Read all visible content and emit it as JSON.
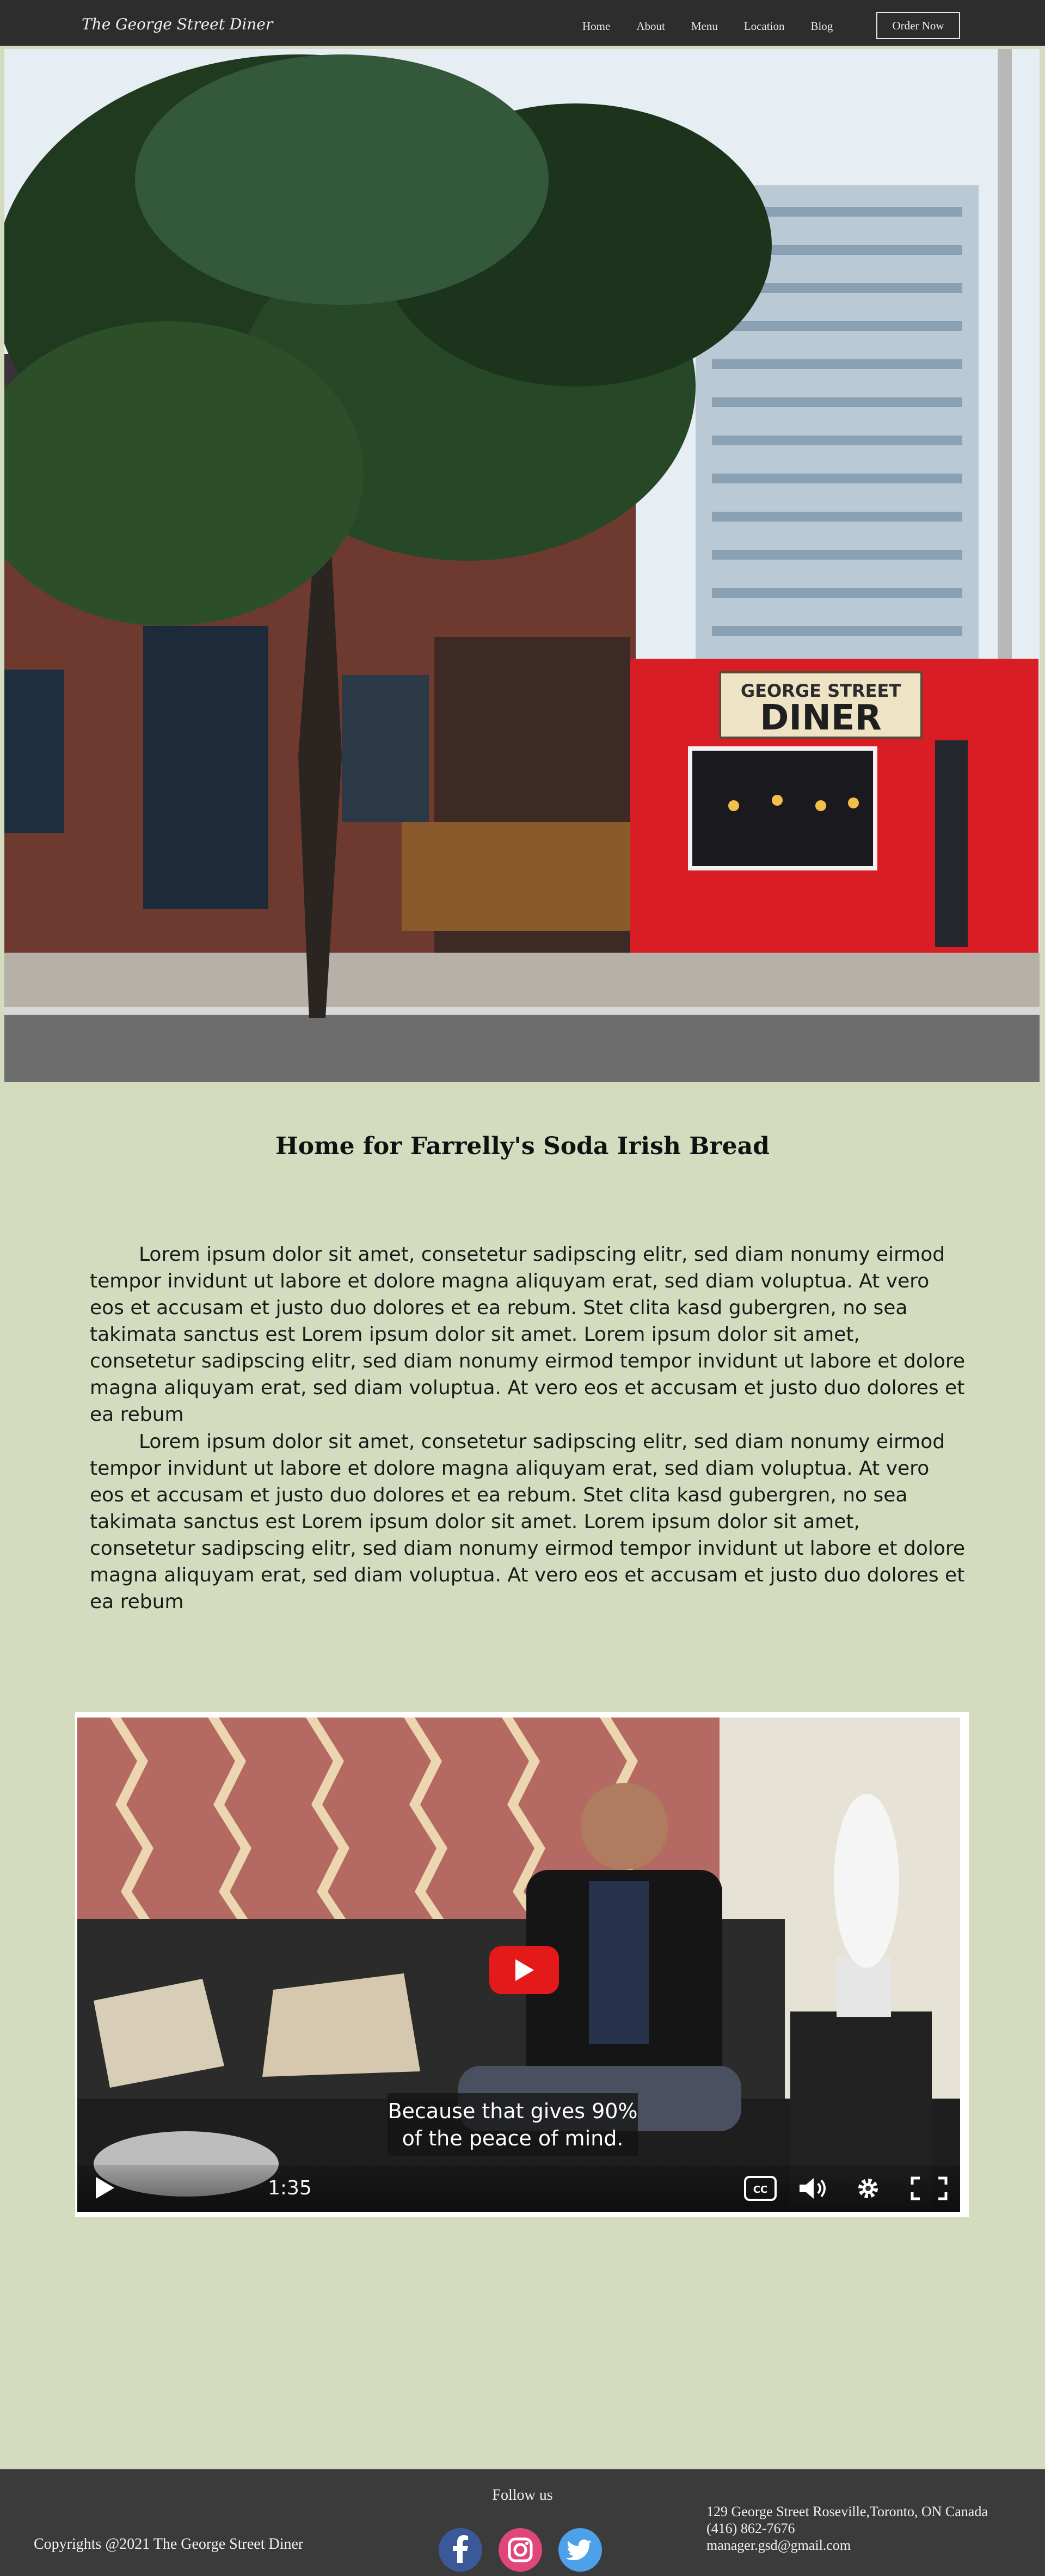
{
  "nav": {
    "brand": "The George Street Diner",
    "links": [
      "Home",
      "About",
      "Menu",
      "Location",
      "Blog"
    ],
    "cta": "Order Now"
  },
  "hero": {
    "sign_line1": "GEORGE STREET",
    "sign_line2": "DINER"
  },
  "main": {
    "title": "Home for Farrelly's Soda Irish Bread",
    "paragraph1": "Lorem ipsum dolor sit amet, consetetur sadipscing elitr, sed diam nonumy eirmod tempor invidunt ut labore et dolore magna aliquyam erat, sed diam voluptua. At vero eos et accusam et justo duo dolores et ea rebum. Stet clita kasd gubergren, no sea takimata sanctus est Lorem ipsum dolor sit amet. Lorem ipsum dolor sit amet, consetetur sadipscing elitr, sed diam nonumy eirmod tempor invidunt ut labore et dolore magna aliquyam erat, sed diam voluptua. At vero eos et accusam et justo duo dolores et ea rebum",
    "paragraph2": "Lorem ipsum dolor sit amet, consetetur sadipscing elitr, sed diam nonumy eirmod tempor invidunt ut labore et dolore magna aliquyam erat, sed diam voluptua. At vero eos et accusam et justo duo dolores et ea rebum. Stet clita kasd gubergren, no sea takimata sanctus est Lorem ipsum dolor sit amet. Lorem ipsum dolor sit amet, consetetur sadipscing elitr, sed diam nonumy eirmod tempor invidunt ut labore et dolore magna aliquyam erat, sed diam voluptua. At vero eos et accusam et justo duo dolores et ea rebum"
  },
  "video": {
    "caption_line1": "Because that gives 90%",
    "caption_line2": "of the peace of mind.",
    "time": "1:35",
    "accent": "#e41a1a",
    "icons": [
      "play-icon",
      "cc-icon",
      "volume-icon",
      "settings-icon",
      "fullscreen-icon"
    ]
  },
  "footer": {
    "copyright": "Copyrights @2021 The George Street Diner",
    "follow": "Follow us",
    "address": "129 George Street Roseville,Toronto, ON Canada",
    "phone": "(416) 862-7676",
    "email": "manager.gsd@gmail.com",
    "socials": [
      "facebook-icon",
      "instagram-icon",
      "twitter-icon"
    ]
  }
}
